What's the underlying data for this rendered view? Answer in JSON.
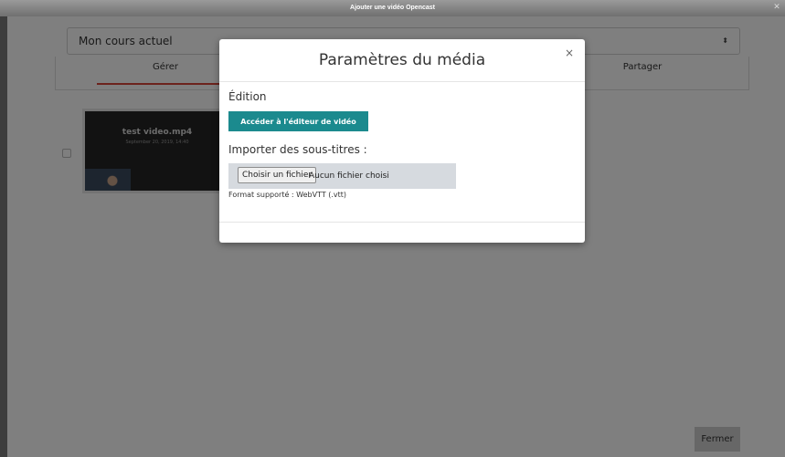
{
  "window": {
    "title": "Ajouter une vidéo Opencast",
    "close_glyph": "✕"
  },
  "course_select": {
    "value": "Mon cours actuel",
    "arrow_glyph": "⬍"
  },
  "tabs": {
    "manage": "Gérer",
    "share": "Partager"
  },
  "video": {
    "title": "test video.mp4",
    "date": "September 20, 2019, 14:40"
  },
  "footer": {
    "close_label": "Fermer"
  },
  "modal": {
    "title": "Paramètres du média",
    "close_glyph": "×",
    "edit_heading": "Édition",
    "editor_button": "Accéder à l'éditeur de vidéo",
    "subtitles_heading": "Importer des sous-titres :",
    "choose_file_button": "Choisir un fichier",
    "file_status": "Aucun fichier choisi",
    "format_note": "Format supporté : WebVTT (.vtt)"
  },
  "colors": {
    "accent": "#1b8a8e",
    "tab_active": "#d9473b"
  },
  "icons": {
    "window_close": "close-icon",
    "select_arrow": "chevron-updown-icon",
    "modal_close": "close-icon"
  }
}
